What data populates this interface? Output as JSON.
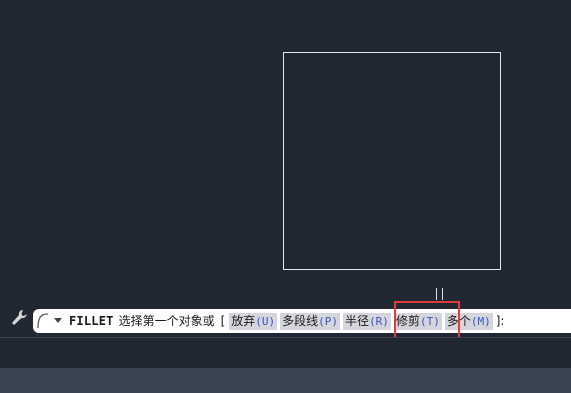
{
  "command_line": {
    "command": "FILLET",
    "prompt": "选择第一个对象或",
    "open_bracket": "[",
    "options": [
      {
        "label": "放弃",
        "key": "(U)"
      },
      {
        "label": "多段线",
        "key": "(P)"
      },
      {
        "label": "半径",
        "key": "(R)"
      },
      {
        "label": "修剪",
        "key": "(T)"
      },
      {
        "label": "多个",
        "key": "(M)"
      }
    ],
    "close_bracket": "]:"
  },
  "colors": {
    "canvas_background": "#222833",
    "highlight": "#e23b3b",
    "option_key": "#3a55c9"
  },
  "icons": {
    "customize": "wrench-icon",
    "command_swirl": "command-swirl-icon",
    "dropdown": "caret-down-icon"
  }
}
